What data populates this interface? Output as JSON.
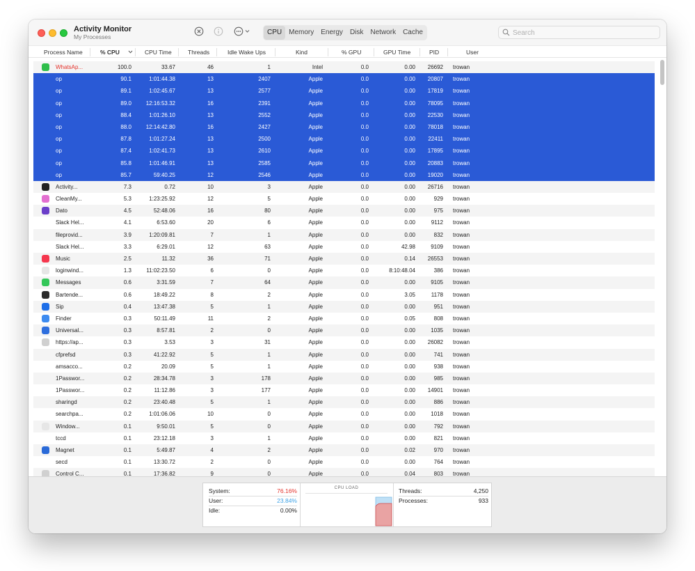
{
  "app": {
    "title": "Activity Monitor",
    "subtitle": "My Processes"
  },
  "toolbar": {
    "stop_icon": "x-circle-icon",
    "info_icon": "info-icon",
    "more_icon": "ellipsis-circle-icon",
    "tabs": [
      {
        "label": "CPU",
        "active": true
      },
      {
        "label": "Memory",
        "active": false
      },
      {
        "label": "Energy",
        "active": false
      },
      {
        "label": "Disk",
        "active": false
      },
      {
        "label": "Network",
        "active": false
      },
      {
        "label": "Cache",
        "active": false
      }
    ],
    "search_placeholder": "Search"
  },
  "columns": [
    "Process Name",
    "% CPU",
    "CPU Time",
    "Threads",
    "Idle Wake Ups",
    "Kind",
    "% GPU",
    "GPU Time",
    "PID",
    "User"
  ],
  "processes": [
    {
      "name": "WhatsAp...",
      "cpu": "100.0",
      "time": "33.67",
      "threads": "46",
      "idle": "1",
      "kind": "Intel",
      "gpu": "0.0",
      "gputime": "0.00",
      "pid": "26692",
      "user": "trowan",
      "icon": "whatsapp-icon",
      "icon_color": "#2fbe4b",
      "selected": false,
      "red": true
    },
    {
      "name": "op",
      "cpu": "90.1",
      "time": "1:01:44.38",
      "threads": "13",
      "idle": "2407",
      "kind": "Apple",
      "gpu": "0.0",
      "gputime": "0.00",
      "pid": "20807",
      "user": "trowan",
      "icon": "",
      "icon_color": "",
      "selected": true
    },
    {
      "name": "op",
      "cpu": "89.1",
      "time": "1:02:45.67",
      "threads": "13",
      "idle": "2577",
      "kind": "Apple",
      "gpu": "0.0",
      "gputime": "0.00",
      "pid": "17819",
      "user": "trowan",
      "icon": "",
      "icon_color": "",
      "selected": true
    },
    {
      "name": "op",
      "cpu": "89.0",
      "time": "12:16:53.32",
      "threads": "16",
      "idle": "2391",
      "kind": "Apple",
      "gpu": "0.0",
      "gputime": "0.00",
      "pid": "78095",
      "user": "trowan",
      "icon": "",
      "icon_color": "",
      "selected": true
    },
    {
      "name": "op",
      "cpu": "88.4",
      "time": "1:01:26.10",
      "threads": "13",
      "idle": "2552",
      "kind": "Apple",
      "gpu": "0.0",
      "gputime": "0.00",
      "pid": "22530",
      "user": "trowan",
      "icon": "",
      "icon_color": "",
      "selected": true
    },
    {
      "name": "op",
      "cpu": "88.0",
      "time": "12:14:42.80",
      "threads": "16",
      "idle": "2427",
      "kind": "Apple",
      "gpu": "0.0",
      "gputime": "0.00",
      "pid": "78018",
      "user": "trowan",
      "icon": "",
      "icon_color": "",
      "selected": true
    },
    {
      "name": "op",
      "cpu": "87.8",
      "time": "1:01:27.24",
      "threads": "13",
      "idle": "2500",
      "kind": "Apple",
      "gpu": "0.0",
      "gputime": "0.00",
      "pid": "22411",
      "user": "trowan",
      "icon": "",
      "icon_color": "",
      "selected": true
    },
    {
      "name": "op",
      "cpu": "87.4",
      "time": "1:02:41.73",
      "threads": "13",
      "idle": "2610",
      "kind": "Apple",
      "gpu": "0.0",
      "gputime": "0.00",
      "pid": "17895",
      "user": "trowan",
      "icon": "",
      "icon_color": "",
      "selected": true
    },
    {
      "name": "op",
      "cpu": "85.8",
      "time": "1:01:46.91",
      "threads": "13",
      "idle": "2585",
      "kind": "Apple",
      "gpu": "0.0",
      "gputime": "0.00",
      "pid": "20883",
      "user": "trowan",
      "icon": "",
      "icon_color": "",
      "selected": true
    },
    {
      "name": "op",
      "cpu": "85.7",
      "time": "59:40.25",
      "threads": "12",
      "idle": "2546",
      "kind": "Apple",
      "gpu": "0.0",
      "gputime": "0.00",
      "pid": "19020",
      "user": "trowan",
      "icon": "",
      "icon_color": "",
      "selected": true
    },
    {
      "name": "Activity...",
      "cpu": "7.3",
      "time": "0.72",
      "threads": "10",
      "idle": "3",
      "kind": "Apple",
      "gpu": "0.0",
      "gputime": "0.00",
      "pid": "26716",
      "user": "trowan",
      "icon": "activity-monitor-icon",
      "icon_color": "#222222",
      "selected": false
    },
    {
      "name": "CleanMy...",
      "cpu": "5.3",
      "time": "1:23:25.92",
      "threads": "12",
      "idle": "5",
      "kind": "Apple",
      "gpu": "0.0",
      "gputime": "0.00",
      "pid": "929",
      "user": "trowan",
      "icon": "cleanmymac-icon",
      "icon_color": "#e36fd0",
      "selected": false
    },
    {
      "name": "Dato",
      "cpu": "4.5",
      "time": "52:48.06",
      "threads": "16",
      "idle": "80",
      "kind": "Apple",
      "gpu": "0.0",
      "gputime": "0.00",
      "pid": "975",
      "user": "trowan",
      "icon": "dato-icon",
      "icon_color": "#6b3fc9",
      "selected": false
    },
    {
      "name": "Slack Hel...",
      "cpu": "4.1",
      "time": "6:53.60",
      "threads": "20",
      "idle": "6",
      "kind": "Apple",
      "gpu": "0.0",
      "gputime": "0.00",
      "pid": "9112",
      "user": "trowan",
      "icon": "",
      "icon_color": "",
      "selected": false
    },
    {
      "name": "fileprovid...",
      "cpu": "3.9",
      "time": "1:20:09.81",
      "threads": "7",
      "idle": "1",
      "kind": "Apple",
      "gpu": "0.0",
      "gputime": "0.00",
      "pid": "832",
      "user": "trowan",
      "icon": "",
      "icon_color": "",
      "selected": false
    },
    {
      "name": "Slack Hel...",
      "cpu": "3.3",
      "time": "6:29.01",
      "threads": "12",
      "idle": "63",
      "kind": "Apple",
      "gpu": "0.0",
      "gputime": "42.98",
      "pid": "9109",
      "user": "trowan",
      "icon": "",
      "icon_color": "",
      "selected": false
    },
    {
      "name": "Music",
      "cpu": "2.5",
      "time": "11.32",
      "threads": "36",
      "idle": "71",
      "kind": "Apple",
      "gpu": "0.0",
      "gputime": "0.14",
      "pid": "26553",
      "user": "trowan",
      "icon": "music-icon",
      "icon_color": "#f5374e",
      "selected": false
    },
    {
      "name": "loginwind...",
      "cpu": "1.3",
      "time": "11:02:23.50",
      "threads": "6",
      "idle": "0",
      "kind": "Apple",
      "gpu": "0.0",
      "gputime": "8:10:48.04",
      "pid": "386",
      "user": "trowan",
      "icon": "loginwindow-icon",
      "icon_color": "#e6e6e6",
      "selected": false
    },
    {
      "name": "Messages",
      "cpu": "0.6",
      "time": "3:31.59",
      "threads": "7",
      "idle": "64",
      "kind": "Apple",
      "gpu": "0.0",
      "gputime": "0.00",
      "pid": "9105",
      "user": "trowan",
      "icon": "messages-icon",
      "icon_color": "#34c759",
      "selected": false
    },
    {
      "name": "Bartende...",
      "cpu": "0.6",
      "time": "18:49.22",
      "threads": "8",
      "idle": "2",
      "kind": "Apple",
      "gpu": "0.0",
      "gputime": "3.05",
      "pid": "1178",
      "user": "trowan",
      "icon": "bartender-icon",
      "icon_color": "#2b2b2b",
      "selected": false
    },
    {
      "name": "Sip",
      "cpu": "0.4",
      "time": "13:47.38",
      "threads": "5",
      "idle": "1",
      "kind": "Apple",
      "gpu": "0.0",
      "gputime": "0.00",
      "pid": "951",
      "user": "trowan",
      "icon": "sip-icon",
      "icon_color": "#1d6ee8",
      "selected": false
    },
    {
      "name": "Finder",
      "cpu": "0.3",
      "time": "50:11.49",
      "threads": "11",
      "idle": "2",
      "kind": "Apple",
      "gpu": "0.0",
      "gputime": "0.05",
      "pid": "808",
      "user": "trowan",
      "icon": "finder-icon",
      "icon_color": "#3d8bf0",
      "selected": false
    },
    {
      "name": "Universal...",
      "cpu": "0.3",
      "time": "8:57.81",
      "threads": "2",
      "idle": "0",
      "kind": "Apple",
      "gpu": "0.0",
      "gputime": "0.00",
      "pid": "1035",
      "user": "trowan",
      "icon": "universal-control-icon",
      "icon_color": "#2f6fde",
      "selected": false
    },
    {
      "name": "https://ap...",
      "cpu": "0.3",
      "time": "3.53",
      "threads": "3",
      "idle": "31",
      "kind": "Apple",
      "gpu": "0.0",
      "gputime": "0.00",
      "pid": "26082",
      "user": "trowan",
      "icon": "shield-icon",
      "icon_color": "#d0d0d0",
      "selected": false
    },
    {
      "name": "cfprefsd",
      "cpu": "0.3",
      "time": "41:22.92",
      "threads": "5",
      "idle": "1",
      "kind": "Apple",
      "gpu": "0.0",
      "gputime": "0.00",
      "pid": "741",
      "user": "trowan",
      "icon": "",
      "icon_color": "",
      "selected": false
    },
    {
      "name": "amsacco...",
      "cpu": "0.2",
      "time": "20.09",
      "threads": "5",
      "idle": "1",
      "kind": "Apple",
      "gpu": "0.0",
      "gputime": "0.00",
      "pid": "938",
      "user": "trowan",
      "icon": "",
      "icon_color": "",
      "selected": false
    },
    {
      "name": "1Passwor...",
      "cpu": "0.2",
      "time": "28:34.78",
      "threads": "3",
      "idle": "178",
      "kind": "Apple",
      "gpu": "0.0",
      "gputime": "0.00",
      "pid": "985",
      "user": "trowan",
      "icon": "",
      "icon_color": "",
      "selected": false
    },
    {
      "name": "1Passwor...",
      "cpu": "0.2",
      "time": "11:12.86",
      "threads": "3",
      "idle": "177",
      "kind": "Apple",
      "gpu": "0.0",
      "gputime": "0.00",
      "pid": "14901",
      "user": "trowan",
      "icon": "",
      "icon_color": "",
      "selected": false
    },
    {
      "name": "sharingd",
      "cpu": "0.2",
      "time": "23:40.48",
      "threads": "5",
      "idle": "1",
      "kind": "Apple",
      "gpu": "0.0",
      "gputime": "0.00",
      "pid": "886",
      "user": "trowan",
      "icon": "",
      "icon_color": "",
      "selected": false
    },
    {
      "name": "searchpa...",
      "cpu": "0.2",
      "time": "1:01:06.06",
      "threads": "10",
      "idle": "0",
      "kind": "Apple",
      "gpu": "0.0",
      "gputime": "0.00",
      "pid": "1018",
      "user": "trowan",
      "icon": "",
      "icon_color": "",
      "selected": false
    },
    {
      "name": "Window...",
      "cpu": "0.1",
      "time": "9:50.01",
      "threads": "5",
      "idle": "0",
      "kind": "Apple",
      "gpu": "0.0",
      "gputime": "0.00",
      "pid": "792",
      "user": "trowan",
      "icon": "window-manager-icon",
      "icon_color": "#e6e6e6",
      "selected": false
    },
    {
      "name": "tccd",
      "cpu": "0.1",
      "time": "23:12.18",
      "threads": "3",
      "idle": "1",
      "kind": "Apple",
      "gpu": "0.0",
      "gputime": "0.00",
      "pid": "821",
      "user": "trowan",
      "icon": "",
      "icon_color": "",
      "selected": false
    },
    {
      "name": "Magnet",
      "cpu": "0.1",
      "time": "5:49.87",
      "threads": "4",
      "idle": "2",
      "kind": "Apple",
      "gpu": "0.0",
      "gputime": "0.02",
      "pid": "970",
      "user": "trowan",
      "icon": "magnet-icon",
      "icon_color": "#2a6ad8",
      "selected": false
    },
    {
      "name": "secd",
      "cpu": "0.1",
      "time": "13:30.72",
      "threads": "2",
      "idle": "0",
      "kind": "Apple",
      "gpu": "0.0",
      "gputime": "0.00",
      "pid": "764",
      "user": "trowan",
      "icon": "",
      "icon_color": "",
      "selected": false
    },
    {
      "name": "Control C...",
      "cpu": "0.1",
      "time": "17:36.82",
      "threads": "9",
      "idle": "0",
      "kind": "Apple",
      "gpu": "0.0",
      "gputime": "0.04",
      "pid": "803",
      "user": "trowan",
      "icon": "control-center-icon",
      "icon_color": "#d0d0d0",
      "selected": false
    }
  ],
  "footer": {
    "system_label": "System:",
    "system_value": "76.16%",
    "user_label": "User:",
    "user_value": "23.84%",
    "idle_label": "Idle:",
    "idle_value": "0.00%",
    "cpu_load_title": "CPU LOAD",
    "threads_label": "Threads:",
    "threads_value": "4,250",
    "processes_label": "Processes:",
    "processes_value": "933"
  },
  "colors": {
    "selection": "#2a5ad6",
    "system_red": "#e5312a",
    "user_blue": "#3ea2e6"
  }
}
